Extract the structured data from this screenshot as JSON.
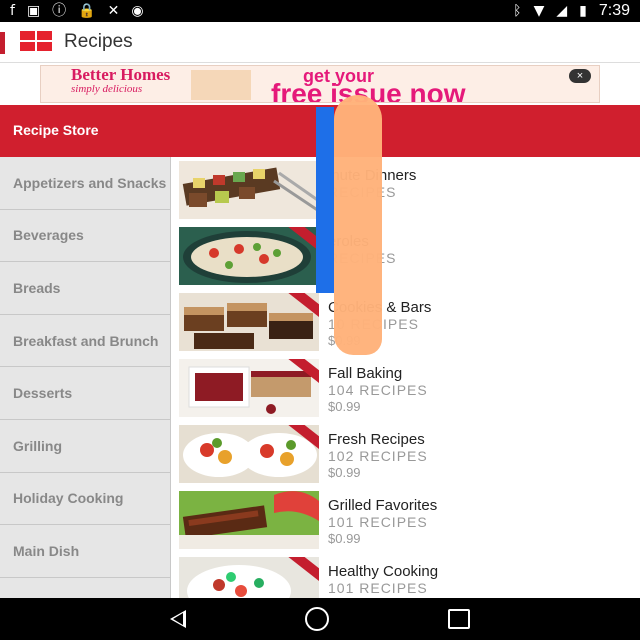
{
  "status_bar": {
    "time": "7:39",
    "left_icons": [
      "facebook-icon",
      "image-icon",
      "info-icon",
      "lock-icon",
      "wifi-off-icon",
      "android-icon"
    ],
    "right_icons": [
      "bluetooth-icon",
      "wifi-icon",
      "signal-icon",
      "battery-icon"
    ]
  },
  "app_bar": {
    "title": "Recipes"
  },
  "ad": {
    "logo_line1": "Better",
    "logo_line2": "Homes",
    "logo_line3": "simply delicious",
    "headline1": "get your",
    "headline2": "free issue now",
    "close": "×"
  },
  "store": {
    "title": "Recipe Store"
  },
  "categories": [
    "Appetizers and Snacks",
    "Beverages",
    "Breads",
    "Breakfast and Brunch",
    "Desserts",
    "Grilling",
    "Holiday Cooking",
    "Main Dish",
    ""
  ],
  "items": [
    {
      "title": "inute Dinners",
      "count": "RECIPES",
      "price": ""
    },
    {
      "title": "eroles",
      "count": "RECIPES",
      "price": ""
    },
    {
      "title": "Cookies & Bars",
      "count": "10 RECIPES",
      "price": "$0.99"
    },
    {
      "title": "Fall Baking",
      "count": "104 RECIPES",
      "price": "$0.99"
    },
    {
      "title": "Fresh Recipes",
      "count": "102 RECIPES",
      "price": "$0.99"
    },
    {
      "title": "Grilled Favorites",
      "count": "101 RECIPES",
      "price": "$0.99"
    },
    {
      "title": "Healthy Cooking",
      "count": "101 RECIPES",
      "price": ""
    }
  ],
  "colors": {
    "accent_red": "#d01f2e",
    "ad_pink": "#e5197a",
    "overlay_blue": "#1e6fe8",
    "overlay_orange": "#ffb27a"
  }
}
